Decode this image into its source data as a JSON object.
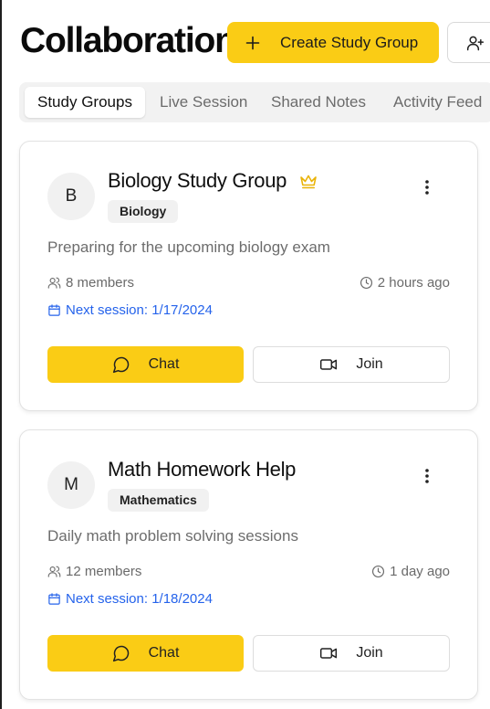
{
  "header": {
    "title": "Collaboration",
    "create_label": "Create Study Group",
    "invite_icon": "user-plus-icon"
  },
  "tabs": [
    {
      "label": "Study Groups",
      "active": true
    },
    {
      "label": "Live Session",
      "active": false
    },
    {
      "label": "Shared Notes",
      "active": false
    },
    {
      "label": "Activity Feed",
      "active": false
    }
  ],
  "groups": [
    {
      "initial": "B",
      "name": "Biology Study Group",
      "owner_badge": "crown-icon",
      "subject": "Biology",
      "description": "Preparing for the upcoming biology exam",
      "members": "8 members",
      "last_active": "2 hours ago",
      "next_session": "Next session: 1/17/2024",
      "chat_label": "Chat",
      "join_label": "Join"
    },
    {
      "initial": "M",
      "name": "Math Homework Help",
      "subject": "Mathematics",
      "description": "Daily math problem solving sessions",
      "members": "12 members",
      "last_active": "1 day ago",
      "next_session": "Next session: 1/18/2024",
      "chat_label": "Chat",
      "join_label": "Join"
    }
  ],
  "colors": {
    "accent": "#facc15",
    "link": "#2563eb",
    "crown": "#eab308"
  }
}
